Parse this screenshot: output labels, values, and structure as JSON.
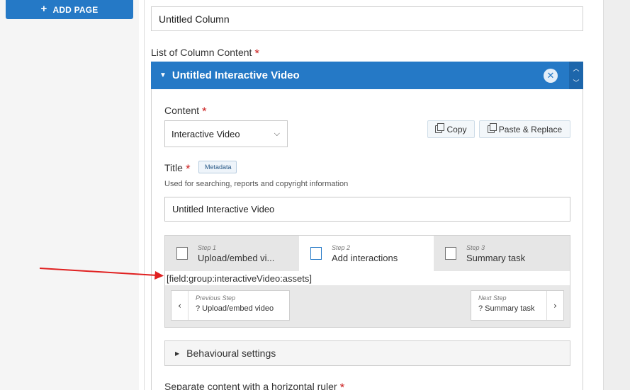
{
  "sidebar": {
    "add_page_label": "ADD PAGE"
  },
  "column": {
    "title_value": "Untitled Column",
    "list_label": "List of Column Content",
    "required_mark": "*"
  },
  "interactive_video": {
    "header_title": "Untitled Interactive Video",
    "content_label": "Content",
    "content_select_value": "Interactive Video",
    "copy_label": "Copy",
    "paste_label": "Paste & Replace",
    "title_label": "Title",
    "metadata_label": "Metadata",
    "title_description": "Used for searching, reports and copyright information",
    "title_value": "Untitled Interactive Video"
  },
  "wizard": {
    "steps": [
      {
        "num": "Step 1",
        "name": "Upload/embed vi..."
      },
      {
        "num": "Step 2",
        "name": "Add interactions"
      },
      {
        "num": "Step 3",
        "name": "Summary task"
      }
    ],
    "active_step": 2,
    "field_group_text": "[field:group:interactiveVideo:assets]",
    "prev_label": "Previous Step",
    "prev_value": "? Upload/embed video",
    "next_label": "Next Step",
    "next_value": "? Summary task"
  },
  "behavioural_settings_label": "Behavioural settings",
  "separator_label": "Separate content with a horizontal ruler",
  "colors": {
    "accent": "#2579c6",
    "required": "#cc2222",
    "annotation_arrow": "#e02020"
  }
}
